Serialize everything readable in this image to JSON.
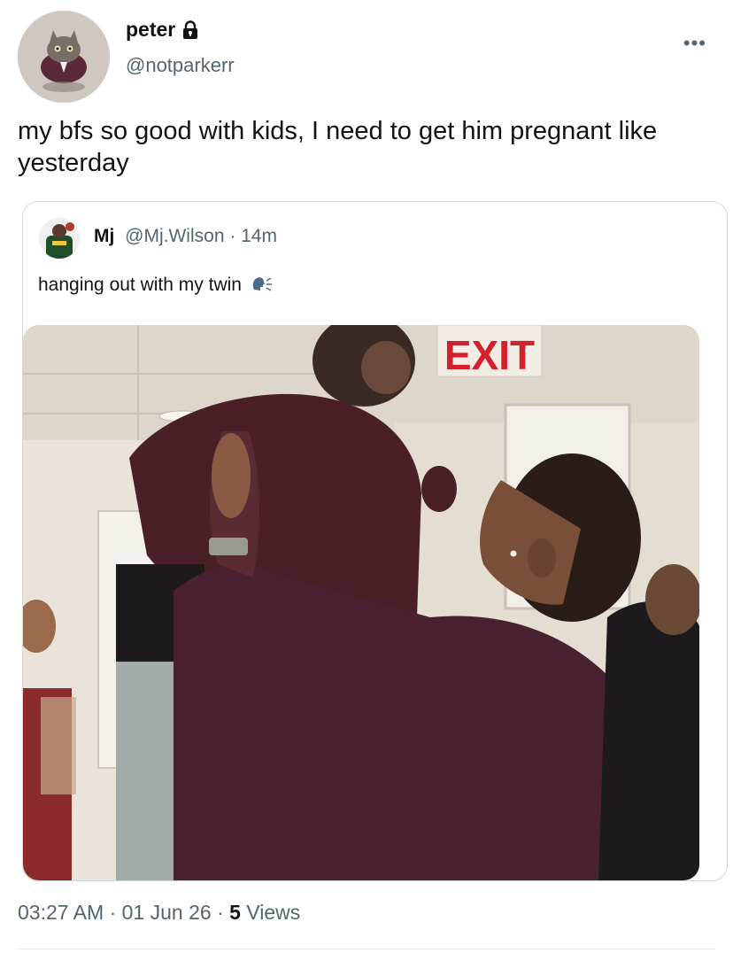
{
  "author": {
    "display_name": "peter",
    "handle": "@notparkerr",
    "protected_icon": "lock-icon",
    "avatar_icon": "cat-avatar"
  },
  "tweet": {
    "text": "my bfs so good with kids, I need to get him pregnant like yesterday",
    "more_icon": "more-icon"
  },
  "quoted_tweet": {
    "display_name": "Mj",
    "handle": "@Mj.Wilson",
    "separator": "·",
    "time": "14m",
    "text": "hanging out with my twin",
    "emoji_icon": "speaking-head-icon",
    "photo": {
      "sign_text": "EXIT"
    }
  },
  "footer": {
    "time": "03:27 AM",
    "sep1": "·",
    "date": "01 Jun 26",
    "sep2": "·",
    "views_count": "5",
    "views_label": "Views"
  },
  "colors": {
    "text_primary": "#0f1419",
    "text_secondary": "#536471",
    "border": "#cfd9de",
    "exit_red": "#d4202a"
  }
}
